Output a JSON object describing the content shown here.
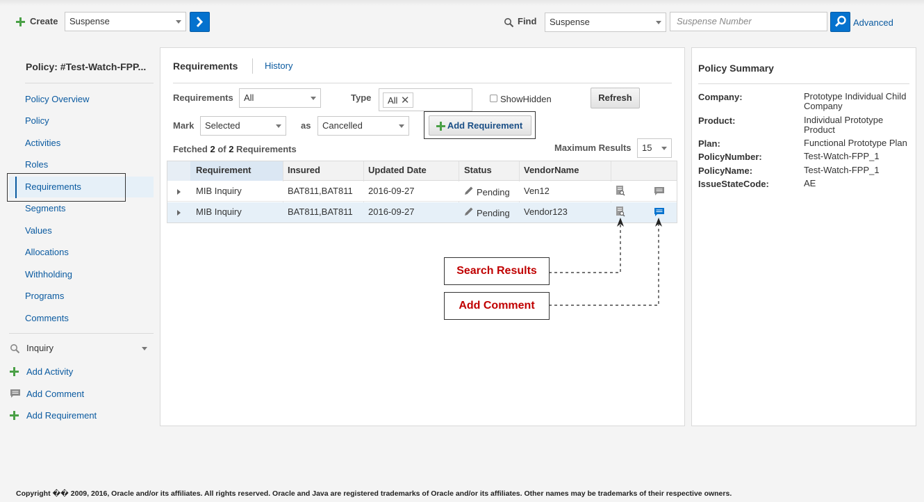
{
  "topbar": {
    "create_label": "Create",
    "create_select": "Suspense",
    "find_label": "Find",
    "find_select": "Suspense",
    "find_placeholder": "Suspense Number",
    "advanced_link": "Advanced"
  },
  "sidebar": {
    "title": "Policy: #Test-Watch-FPP...",
    "items": [
      {
        "label": "Policy Overview"
      },
      {
        "label": "Policy"
      },
      {
        "label": "Activities"
      },
      {
        "label": "Roles"
      },
      {
        "label": "Requirements"
      },
      {
        "label": "Segments"
      },
      {
        "label": "Values"
      },
      {
        "label": "Allocations"
      },
      {
        "label": "Withholding"
      },
      {
        "label": "Programs"
      },
      {
        "label": "Comments"
      }
    ],
    "inquiry_label": "Inquiry",
    "actions": [
      {
        "label": "Add Activity"
      },
      {
        "label": "Add Comment"
      },
      {
        "label": "Add Requirement"
      }
    ]
  },
  "main": {
    "tabs": [
      {
        "label": "Requirements"
      },
      {
        "label": "History"
      }
    ],
    "filters": {
      "requirements_label": "Requirements",
      "requirements_value": "All",
      "type_label": "Type",
      "type_token": "All",
      "show_hidden_label": "ShowHidden",
      "refresh_label": "Refresh",
      "mark_label": "Mark",
      "mark_value": "Selected",
      "as_label": "as",
      "as_value": "Cancelled",
      "add_requirement_label": "Add Requirement"
    },
    "fetched_prefix": "Fetched ",
    "fetched_count": "2",
    "fetched_of": " of ",
    "fetched_total": "2",
    "fetched_suffix": " Requirements",
    "max_results_label": "Maximum Results",
    "max_results_value": "15",
    "table": {
      "columns": [
        "Requirement",
        "Insured",
        "Updated Date",
        "Status",
        "VendorName"
      ],
      "rows": [
        {
          "requirement": "MIB Inquiry",
          "insured": "BAT811,BAT811",
          "date": "2016-09-27",
          "status": "Pending",
          "vendor": "Ven12"
        },
        {
          "requirement": "MIB Inquiry",
          "insured": "BAT811,BAT811",
          "date": "2016-09-27",
          "status": "Pending",
          "vendor": "Vendor123"
        }
      ]
    },
    "callouts": {
      "search_results": "Search Results",
      "add_comment": "Add Comment"
    }
  },
  "summary": {
    "title": "Policy Summary",
    "fields": [
      {
        "key": "Company:",
        "value": "Prototype Individual Child Company"
      },
      {
        "key": "Product:",
        "value": "Individual Prototype Product"
      },
      {
        "key": "Plan:",
        "value": "Functional Prototype Plan"
      },
      {
        "key": "PolicyNumber:",
        "value": "Test-Watch-FPP_1"
      },
      {
        "key": "PolicyName:",
        "value": "Test-Watch-FPP_1"
      },
      {
        "key": "IssueStateCode:",
        "value": "AE"
      }
    ]
  },
  "footer": {
    "copyright": "Copyright �� 2009, 2016, Oracle and/or its affiliates. All rights reserved. Oracle and Java are registered trademarks of Oracle and/or its affiliates. Other names may be trademarks of their respective owners."
  },
  "colors": {
    "accent_blue": "#0572ce",
    "link_blue": "#0a5aa0",
    "plus_green": "#4aa046",
    "callout_red": "#c00000"
  }
}
